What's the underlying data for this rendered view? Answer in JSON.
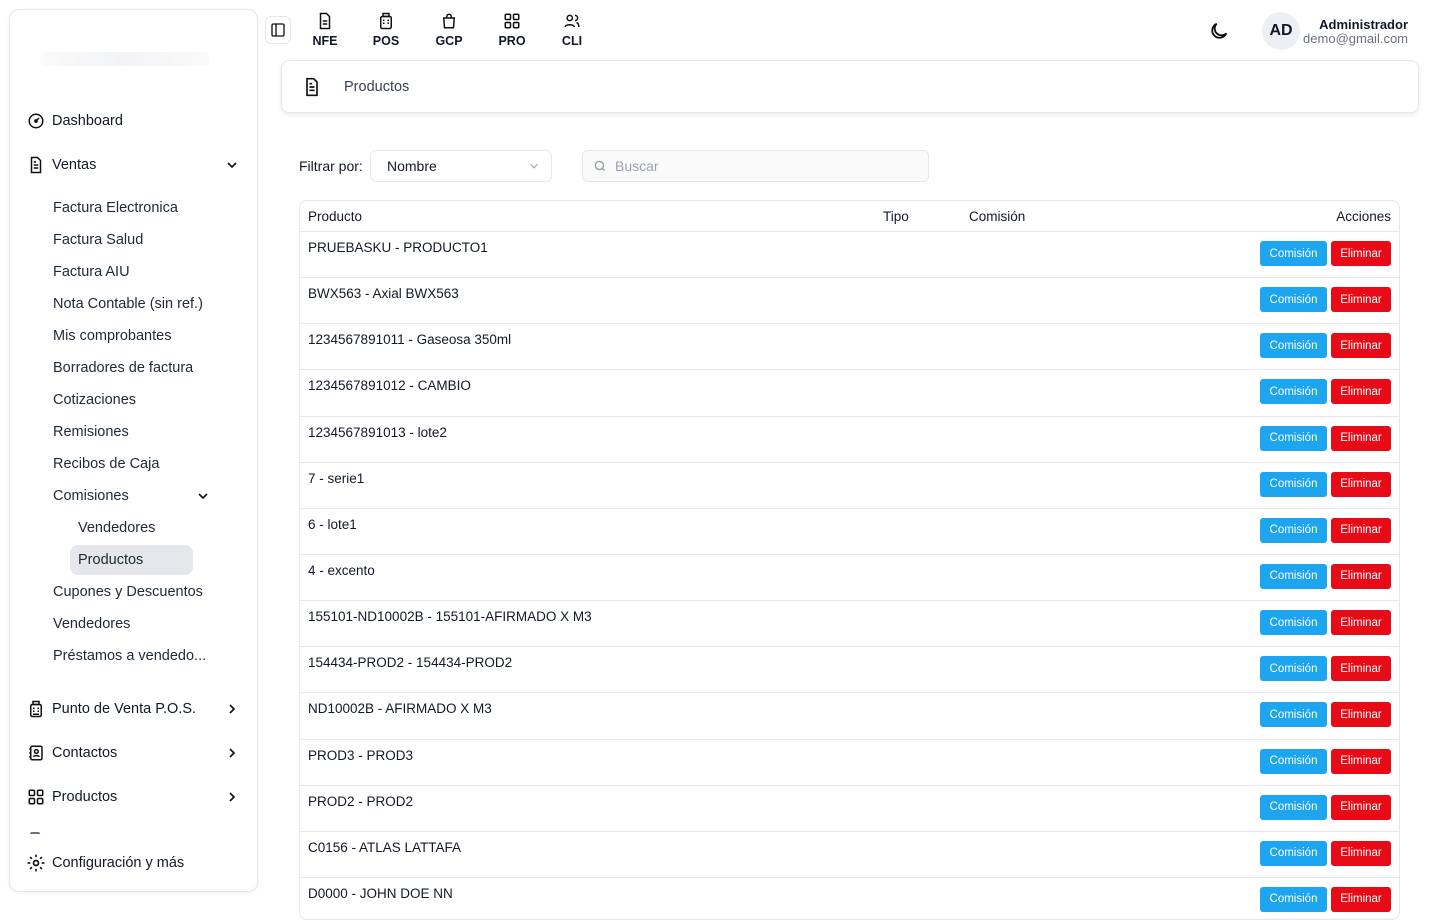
{
  "sidebar": {
    "items": [
      {
        "label": "Dashboard",
        "icon": "dashboard-icon"
      },
      {
        "label": "Ventas",
        "icon": "document-icon"
      },
      {
        "label": "Punto de Venta P.O.S.",
        "icon": "pos-icon"
      },
      {
        "label": "Contactos",
        "icon": "contacts-icon"
      },
      {
        "label": "Productos",
        "icon": "grid-icon"
      },
      {
        "label": "Configuración y más",
        "icon": "gear-icon"
      }
    ],
    "ventas_sub": [
      "Factura Electronica",
      "Factura Salud",
      "Factura AIU",
      "Nota Contable (sin ref.)",
      "Mis comprobantes",
      "Borradores de factura",
      "Cotizaciones",
      "Remisiones",
      "Recibos de Caja",
      "Comisiones",
      "Cupones y Descuentos",
      "Vendedores",
      "Préstamos a vendedo..."
    ],
    "comisiones_sub": [
      "Vendedores",
      "Productos"
    ],
    "active_item": "Productos"
  },
  "topbar": {
    "apps": [
      {
        "label": "NFE",
        "icon": "document-icon"
      },
      {
        "label": "POS",
        "icon": "pos-icon"
      },
      {
        "label": "GCP",
        "icon": "bag-icon"
      },
      {
        "label": "PRO",
        "icon": "grid-icon"
      },
      {
        "label": "CLI",
        "icon": "users-icon"
      }
    ],
    "user": {
      "initials": "AD",
      "name": "Administrador",
      "email": "demo@gmail.com"
    }
  },
  "breadcrumb": {
    "title": "Productos"
  },
  "filter": {
    "label": "Filtrar por:",
    "selected": "Nombre",
    "search_placeholder": "Buscar"
  },
  "table": {
    "headers": {
      "producto": "Producto",
      "tipo": "Tipo",
      "comision": "Comisión",
      "acciones": "Acciones"
    },
    "btn_comision": "Comisión",
    "btn_eliminar": "Eliminar",
    "rows": [
      "PRUEBASKU - PRODUCTO1",
      "BWX563 - Axial BWX563",
      "1234567891011 - Gaseosa 350ml",
      "1234567891012 - CAMBIO",
      "1234567891013 - lote2",
      "7 - serie1",
      "6 - lote1",
      "4 - excento",
      "155101-ND10002B - 155101-AFIRMADO X M3",
      "154434-PROD2 - 154434-PROD2",
      "ND10002B - AFIRMADO X M3",
      "PROD3 - PROD3",
      "PROD2 - PROD2",
      "C0156 - ATLAS LATTAFA",
      "D0000 - JOHN DOE NN"
    ]
  },
  "colors": {
    "comision_btn": "#1ea5ef",
    "eliminar_btn": "#e60b16",
    "active_bg": "#e5e7eb"
  }
}
